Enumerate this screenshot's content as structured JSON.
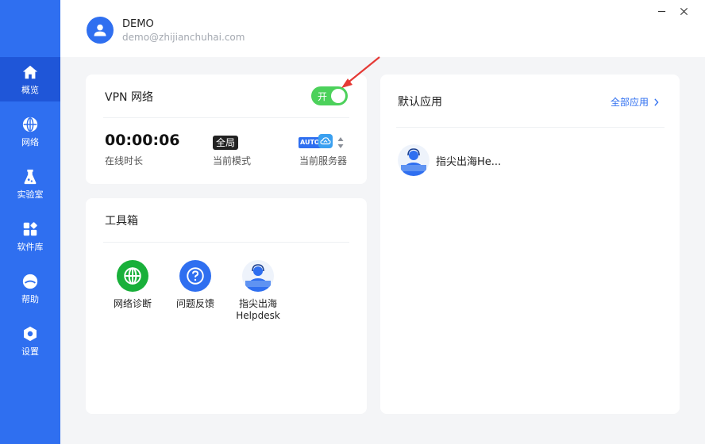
{
  "sidebar": {
    "items": [
      {
        "label": "概览",
        "icon": "home-icon",
        "active": true
      },
      {
        "label": "网络",
        "icon": "globe-icon"
      },
      {
        "label": "实验室",
        "icon": "flask-icon"
      },
      {
        "label": "软件库",
        "icon": "apps-icon"
      },
      {
        "label": "帮助",
        "icon": "help-icon"
      },
      {
        "label": "设置",
        "icon": "gear-icon"
      }
    ]
  },
  "header": {
    "user_name": "DEMO",
    "user_email": "demo@zhijianchuhai.com"
  },
  "vpn": {
    "title": "VPN 网络",
    "toggle_label": "开",
    "toggle_on": true,
    "online_time": "00:00:06",
    "online_time_label": "在线时长",
    "mode_value": "全局",
    "mode_label": "当前模式",
    "server_badge": "AUTO",
    "server_label": "当前服务器"
  },
  "toolbox": {
    "title": "工具箱",
    "tools": [
      {
        "label": "网络诊断",
        "icon": "globe-icon",
        "color": "#19b03a"
      },
      {
        "label": "问题反馈",
        "icon": "question-icon",
        "color": "#2f6ff0"
      },
      {
        "label": "指尖出海",
        "label2": "Helpdesk",
        "icon": "helpdesk-avatar-icon"
      }
    ]
  },
  "default_apps": {
    "title": "默认应用",
    "all_label": "全部应用",
    "apps": [
      {
        "name": "指尖出海He...",
        "icon": "helpdesk-avatar-icon"
      }
    ]
  },
  "colors": {
    "sidebar": "#2f6ff0",
    "sidebar_active": "#1f56d8",
    "toggle_on": "#4cd15b",
    "accent": "#2f6ff0"
  }
}
